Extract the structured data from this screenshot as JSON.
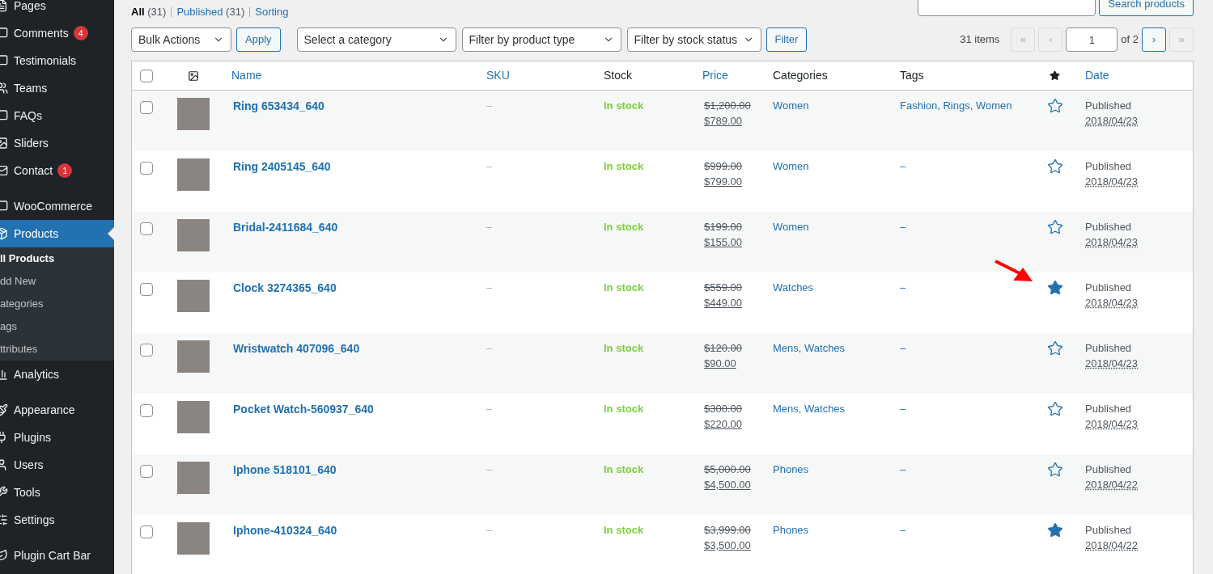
{
  "sidebar": {
    "items": [
      {
        "label": "Pages",
        "kind": "menu",
        "selected": false
      },
      {
        "label": "Comments",
        "kind": "menu",
        "badge": "4",
        "selected": false
      },
      {
        "label": "Testimonials",
        "kind": "menu",
        "selected": false
      },
      {
        "label": "Teams",
        "kind": "menu",
        "selected": false
      },
      {
        "label": "FAQs",
        "kind": "menu",
        "selected": false
      },
      {
        "label": "Sliders",
        "kind": "menu",
        "selected": false
      },
      {
        "label": "Contact",
        "kind": "menu",
        "badge": "1",
        "selected": false
      },
      {
        "label": "WooCommerce",
        "kind": "menu",
        "selected": false
      },
      {
        "label": "Products",
        "kind": "menu",
        "selected": true
      },
      {
        "label": "ll Products",
        "kind": "submenu",
        "selected": true
      },
      {
        "label": "dd New",
        "kind": "submenu",
        "selected": false
      },
      {
        "label": "ategories",
        "kind": "submenu",
        "selected": false
      },
      {
        "label": "ags",
        "kind": "submenu",
        "selected": false
      },
      {
        "label": "ttributes",
        "kind": "submenu",
        "selected": false
      },
      {
        "label": "Analytics",
        "kind": "menu",
        "selected": false
      },
      {
        "label": "Appearance",
        "kind": "menu",
        "selected": false
      },
      {
        "label": "Plugins",
        "kind": "menu",
        "selected": false
      },
      {
        "label": "Users",
        "kind": "menu",
        "selected": false
      },
      {
        "label": "Tools",
        "kind": "menu",
        "selected": false
      },
      {
        "label": "Settings",
        "kind": "menu",
        "selected": false
      },
      {
        "label": "Plugin Cart Bar",
        "kind": "menu",
        "selected": false
      }
    ]
  },
  "views": [
    {
      "label": "All",
      "count": "(31)",
      "selected": true
    },
    {
      "label": "Published",
      "count": "(31)",
      "selected": false
    },
    {
      "label": "Sorting",
      "selected": false
    }
  ],
  "search": {
    "button": "Search products"
  },
  "filters": {
    "bulk": "Bulk Actions",
    "apply": "Apply",
    "category": "Select a category",
    "type": "Filter by product type",
    "stock": "Filter by stock status",
    "filter": "Filter"
  },
  "pagination": {
    "items": "31 items",
    "first": "«",
    "prev": "‹",
    "page": "1",
    "of": "of 2",
    "next": "›",
    "last": "»"
  },
  "table": {
    "select_all_checked": false,
    "columns": [
      "Name",
      "SKU",
      "Stock",
      "Price",
      "Categories",
      "Tags",
      "Date"
    ],
    "rows": [
      {
        "checked": false,
        "name": "Ring 653434_640",
        "sku": "–",
        "stock": "In stock",
        "old_price": "$1,200.00",
        "price": "$789.00",
        "categories": "Women",
        "tags": "Fashion, Rings, Women",
        "featured": false,
        "status": "Published",
        "date": "2018/04/23",
        "annotated": false
      },
      {
        "checked": false,
        "name": "Ring 2405145_640",
        "sku": "–",
        "stock": "In stock",
        "old_price": "$999.00",
        "price": "$799.00",
        "categories": "Women",
        "tags": "–",
        "featured": false,
        "status": "Published",
        "date": "2018/04/23",
        "annotated": false
      },
      {
        "checked": false,
        "name": "Bridal-2411684_640",
        "sku": "–",
        "stock": "In stock",
        "old_price": "$199.00",
        "price": "$155.00",
        "categories": "Women",
        "tags": "–",
        "featured": false,
        "status": "Published",
        "date": "2018/04/23",
        "annotated": false
      },
      {
        "checked": false,
        "name": "Clock 3274365_640",
        "sku": "–",
        "stock": "In stock",
        "old_price": "$559.00",
        "price": "$449.00",
        "categories": "Watches",
        "tags": "–",
        "featured": true,
        "status": "Published",
        "date": "2018/04/23",
        "annotated": true
      },
      {
        "checked": false,
        "name": "Wristwatch 407096_640",
        "sku": "–",
        "stock": "In stock",
        "old_price": "$120.00",
        "price": "$90.00",
        "categories": "Mens, Watches",
        "tags": "–",
        "featured": false,
        "status": "Published",
        "date": "2018/04/23",
        "annotated": false
      },
      {
        "checked": false,
        "name": "Pocket Watch-560937_640",
        "sku": "–",
        "stock": "In stock",
        "old_price": "$300.00",
        "price": "$220.00",
        "categories": "Mens, Watches",
        "tags": "–",
        "featured": false,
        "status": "Published",
        "date": "2018/04/23",
        "annotated": false
      },
      {
        "checked": false,
        "name": "Iphone 518101_640",
        "sku": "–",
        "stock": "In stock",
        "old_price": "$5,000.00",
        "price": "$4,500.00",
        "categories": "Phones",
        "tags": "–",
        "featured": false,
        "status": "Published",
        "date": "2018/04/22",
        "annotated": false
      },
      {
        "checked": false,
        "name": "Iphone-410324_640",
        "sku": "–",
        "stock": "In stock",
        "old_price": "$3,999.00",
        "price": "$3,500.00",
        "categories": "Phones",
        "tags": "–",
        "featured": true,
        "status": "Published",
        "date": "2018/04/22",
        "annotated": false
      }
    ]
  }
}
